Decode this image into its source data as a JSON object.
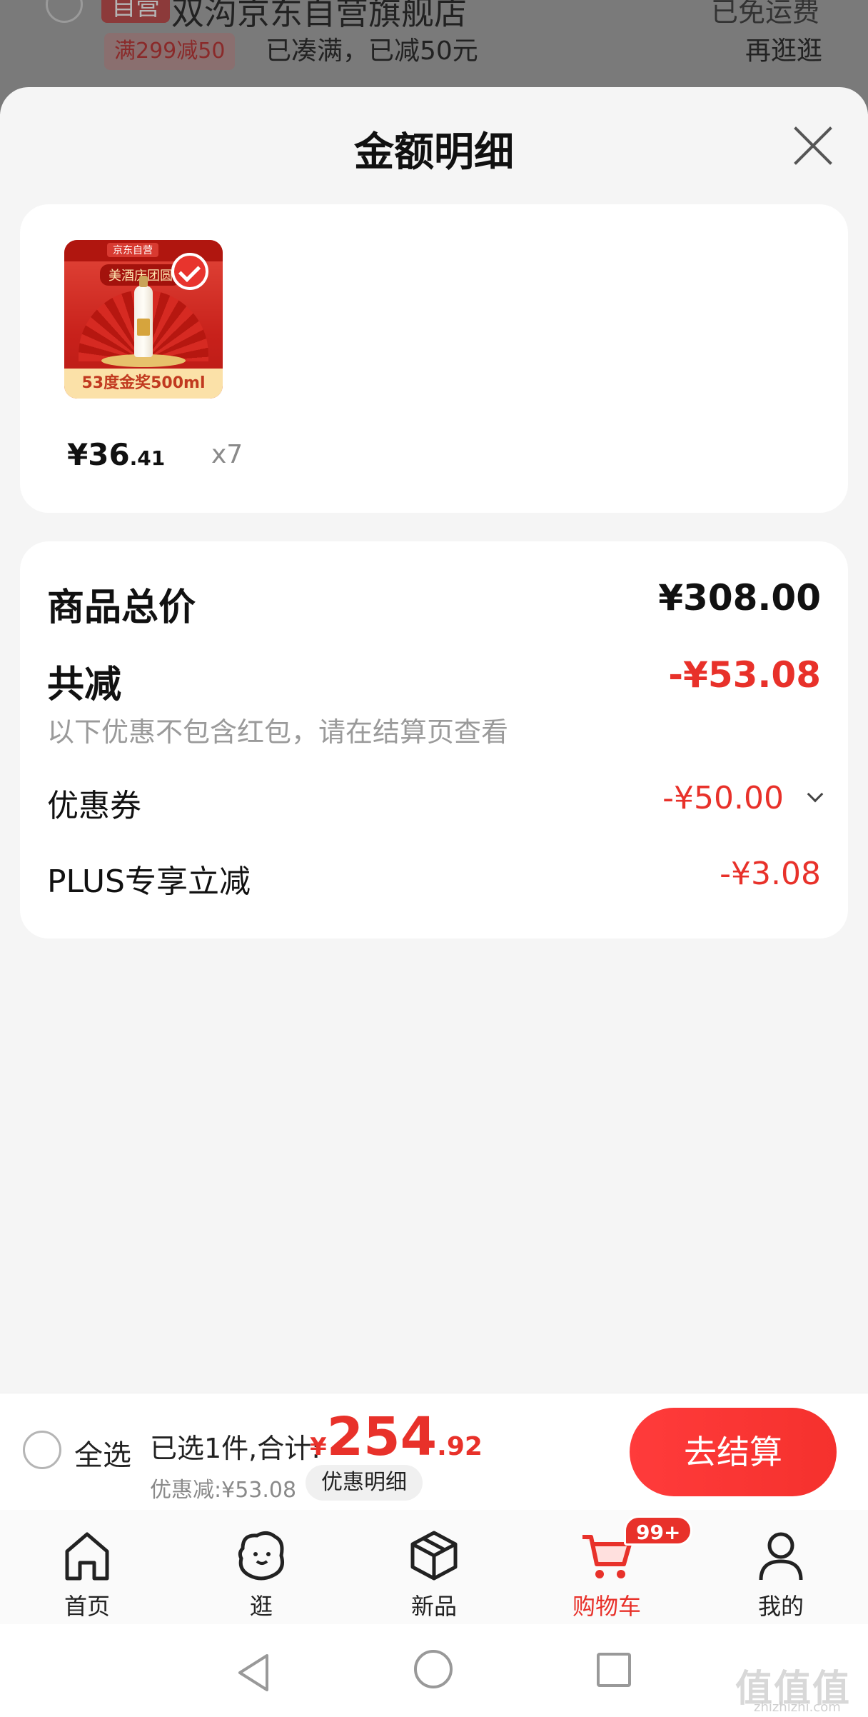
{
  "background_store": {
    "tag": "自营",
    "store_name": "双沟京东自营旗舰店",
    "shipping": "已免运费",
    "promo_tag": "满299减50",
    "promo_text": "已凑满，已减50元",
    "more_link": "再逛逛"
  },
  "sheet": {
    "title": "金额明细"
  },
  "product": {
    "thumb_brand": "京东自营",
    "thumb_banner": "美酒庆团圆",
    "thumb_spec": "53度金奖500ml",
    "price_int": "¥36",
    "price_dec": ".41",
    "quantity": "x7"
  },
  "summary": {
    "total_label": "商品总价",
    "total_value": "¥308.00",
    "reduce_label": "共减",
    "reduce_value": "-¥53.08",
    "note": "以下优惠不包含红包，请在结算页查看",
    "coupon_label": "优惠券",
    "coupon_value": "-¥50.00",
    "plus_label": "PLUS专享立减",
    "plus_value": "-¥3.08"
  },
  "checkout": {
    "select_all": "全选",
    "selected_text": "已选1件,合计:",
    "amount_yen": "¥",
    "amount_int": "254",
    "amount_dec": ".92",
    "discount_text": "优惠减:¥53.08",
    "detail_button": "优惠明细",
    "go_button": "去结算"
  },
  "tabs": [
    {
      "label": "首页",
      "icon": "home-icon"
    },
    {
      "label": "逛",
      "icon": "explore-icon"
    },
    {
      "label": "新品",
      "icon": "new-product-icon"
    },
    {
      "label": "购物车",
      "icon": "cart-icon",
      "badge": "99+"
    },
    {
      "label": "我的",
      "icon": "profile-icon"
    }
  ],
  "watermark": {
    "logo": "值值值",
    "site": "zhizhizhi.com"
  },
  "colors": {
    "accent_red": "#e8312a",
    "background": "#f5f5f5"
  }
}
